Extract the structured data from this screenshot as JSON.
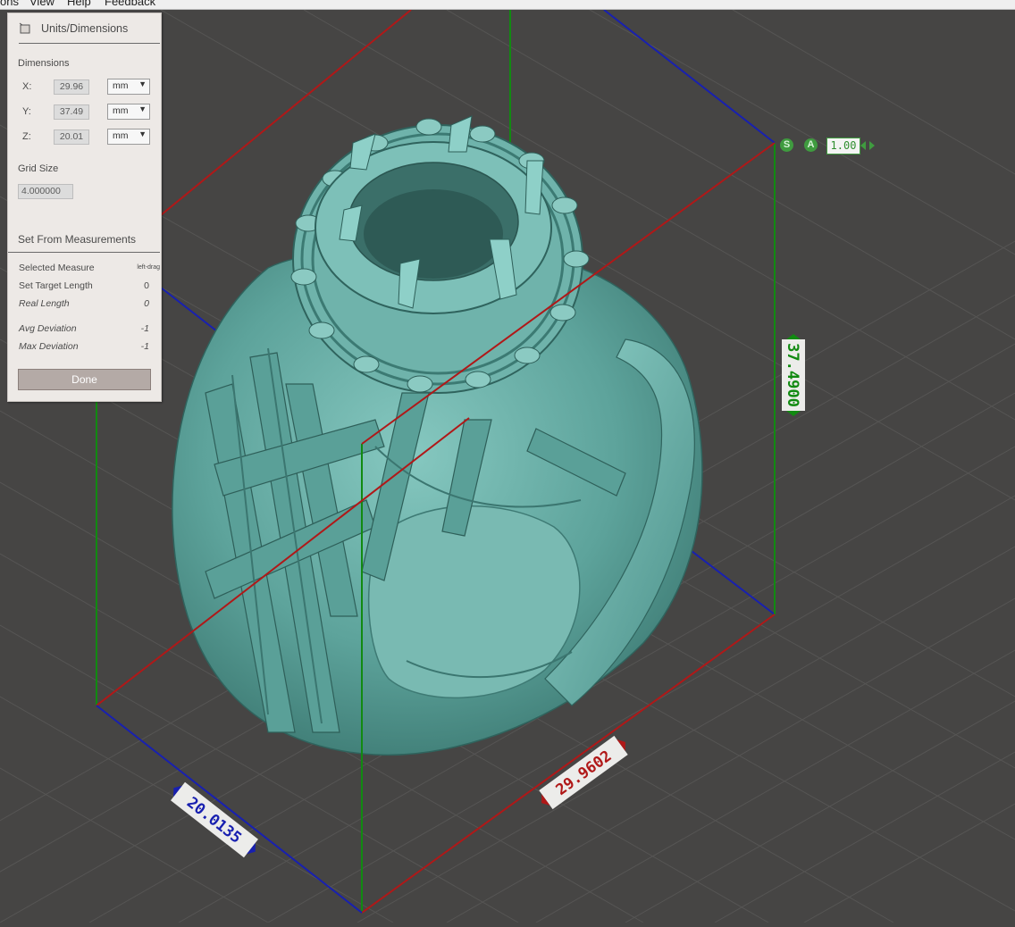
{
  "menubar": {
    "items": [
      "ons",
      "View",
      "Help",
      "Feedback"
    ]
  },
  "panel": {
    "title": "Units/Dimensions",
    "icon": "cube-icon",
    "dimensions_label": "Dimensions",
    "x": {
      "label": "X:",
      "value": "29.96",
      "unit": "mm"
    },
    "y": {
      "label": "Y:",
      "value": "37.49",
      "unit": "mm"
    },
    "z": {
      "label": "Z:",
      "value": "20.01",
      "unit": "mm"
    },
    "grid_size_label": "Grid Size",
    "grid_size_value": "4.000000",
    "set_from_label": "Set From Measurements",
    "rows": [
      {
        "label": "Selected Measure",
        "value": "left-drag"
      },
      {
        "label": "Set Target Length",
        "value": "0"
      },
      {
        "label": "Real Length",
        "value": "0"
      },
      {
        "label": "Avg Deviation",
        "value": "-1"
      },
      {
        "label": "Max Deviation",
        "value": "-1"
      }
    ],
    "done_label": "Done"
  },
  "viewport_controls": {
    "s_label": "S",
    "a_label": "A",
    "scale_value": "1.00"
  },
  "dimension_tags": {
    "y": "37.4900",
    "x": "29.9602",
    "z": "20.0135"
  },
  "colors": {
    "background": "#464544",
    "model": "#6db0a8",
    "x_axis": "#b01818",
    "y_axis": "#118a11",
    "z_axis": "#1820b0"
  }
}
